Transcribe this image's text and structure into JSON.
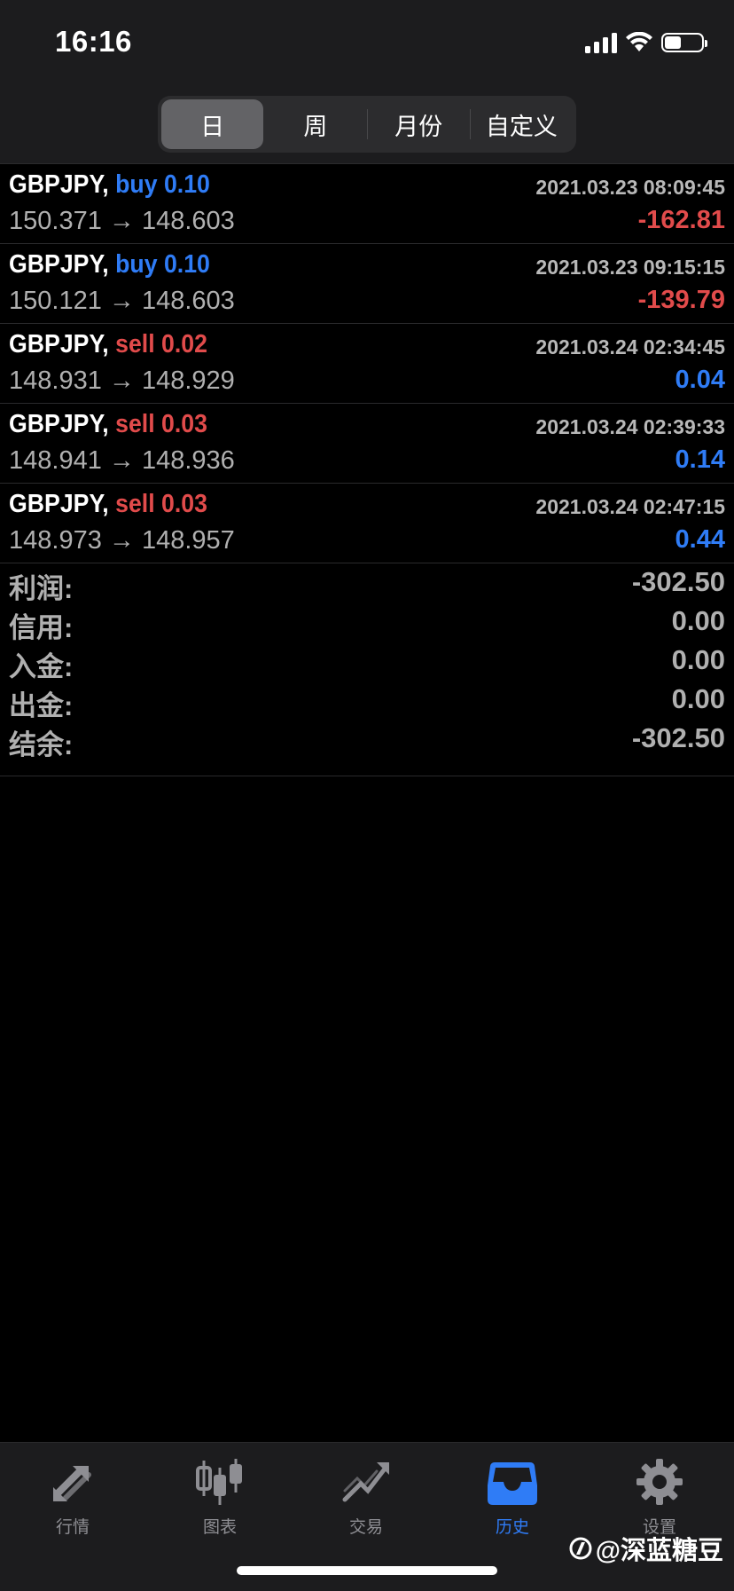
{
  "status_bar": {
    "time": "16:16"
  },
  "segments": [
    {
      "label": "日",
      "active": true
    },
    {
      "label": "周",
      "active": false
    },
    {
      "label": "月份",
      "active": false
    },
    {
      "label": "自定义",
      "active": false
    }
  ],
  "trades": [
    {
      "symbol": "GBPJPY,",
      "side": "buy",
      "volume": "0.10",
      "time": "2021.03.23 08:09:45",
      "open": "150.371",
      "arrow": "→",
      "close": "148.603",
      "profit": "-162.81"
    },
    {
      "symbol": "GBPJPY,",
      "side": "buy",
      "volume": "0.10",
      "time": "2021.03.23 09:15:15",
      "open": "150.121",
      "arrow": "→",
      "close": "148.603",
      "profit": "-139.79"
    },
    {
      "symbol": "GBPJPY,",
      "side": "sell",
      "volume": "0.02",
      "time": "2021.03.24 02:34:45",
      "open": "148.931",
      "arrow": "→",
      "close": "148.929",
      "profit": "0.04"
    },
    {
      "symbol": "GBPJPY,",
      "side": "sell",
      "volume": "0.03",
      "time": "2021.03.24 02:39:33",
      "open": "148.941",
      "arrow": "→",
      "close": "148.936",
      "profit": "0.14"
    },
    {
      "symbol": "GBPJPY,",
      "side": "sell",
      "volume": "0.03",
      "time": "2021.03.24 02:47:15",
      "open": "148.973",
      "arrow": "→",
      "close": "148.957",
      "profit": "0.44"
    }
  ],
  "summary": [
    {
      "label": "利润:",
      "value": "-302.50"
    },
    {
      "label": "信用:",
      "value": "0.00"
    },
    {
      "label": "入金:",
      "value": "0.00"
    },
    {
      "label": "出金:",
      "value": "0.00"
    },
    {
      "label": "结余:",
      "value": "-302.50"
    }
  ],
  "tabs": [
    {
      "label": "行情",
      "icon": "quotes-arrows-icon",
      "active": false
    },
    {
      "label": "图表",
      "icon": "candlestick-chart-icon",
      "active": false
    },
    {
      "label": "交易",
      "icon": "trade-chart-icon",
      "active": false
    },
    {
      "label": "历史",
      "icon": "history-inbox-icon",
      "active": true
    },
    {
      "label": "设置",
      "icon": "gear-icon",
      "active": false
    }
  ],
  "watermark": "@深蓝糖豆",
  "colors": {
    "buy": "#2f7cf6",
    "sell": "#e14b4b",
    "active_tab": "#2f7cf6",
    "inactive": "#8e8e93"
  }
}
